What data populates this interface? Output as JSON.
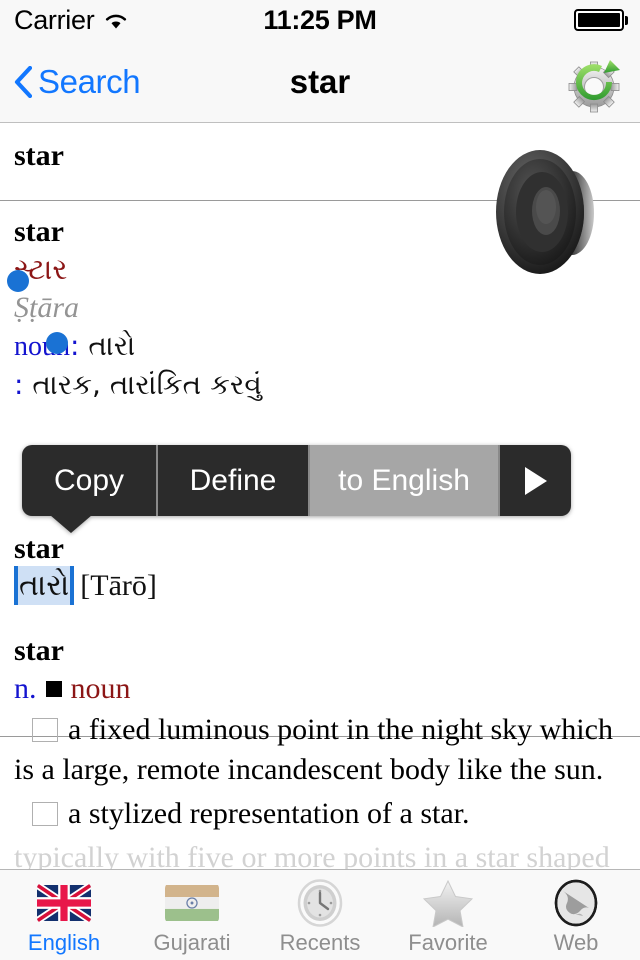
{
  "status_bar": {
    "carrier": "Carrier",
    "wifi_icon": "wifi-icon",
    "time": "11:25 PM",
    "battery_icon": "battery-full-icon"
  },
  "nav_bar": {
    "back_label": "Search",
    "back_icon": "chevron-left-icon",
    "title": "star",
    "sync_icon": "gear-sync-icon"
  },
  "entries": {
    "top_headword": "star",
    "speaker_icon": "speaker-icon",
    "guj_entry": {
      "headword": "star",
      "gujarati": "સ્ટાર",
      "transliteration": "Ṣṭāra",
      "pos_label": "noun",
      "pos_separator": ":",
      "pos_value": "તારો",
      "sense_colon": ":",
      "sense_value": "તારક, તારાંકિત કરવું"
    },
    "selection_entry": {
      "headword": "star",
      "selected_text": "તારો",
      "transliteration": "[Tārō]"
    },
    "english_entry": {
      "headword": "star",
      "pos_abbr": "n.",
      "pos_bullet": "■",
      "pos_full": "noun",
      "definitions": [
        "a fixed luminous point in the night sky which is a large, remote incandescent body like the sun.",
        "a stylized representation of a star.",
        "typically with five or more points in a star shaped symbol indicating a category of"
      ]
    }
  },
  "edit_menu": {
    "items": [
      {
        "label": "Copy",
        "name": "copy",
        "highlighted": false
      },
      {
        "label": "Define",
        "name": "define",
        "highlighted": false
      },
      {
        "label": "to English",
        "name": "to-english",
        "highlighted": true
      }
    ],
    "more_icon": "triangle-right-icon"
  },
  "tab_bar": {
    "tabs": [
      {
        "label": "English",
        "icon": "uk-flag-icon",
        "active": true
      },
      {
        "label": "Gujarati",
        "icon": "india-flag-icon",
        "active": false
      },
      {
        "label": "Recents",
        "icon": "clock-icon",
        "active": false
      },
      {
        "label": "Favorite",
        "icon": "star-icon",
        "active": false
      },
      {
        "label": "Web",
        "icon": "globe-icon",
        "active": false
      }
    ]
  },
  "colors": {
    "accent_blue": "#1277ff",
    "selection_blue": "#1a72d4",
    "gujarati_red": "#8c1616",
    "pos_blue": "#1414cf",
    "menu_dark": "#2b2b2b",
    "menu_highlight": "#a6a6a6"
  }
}
